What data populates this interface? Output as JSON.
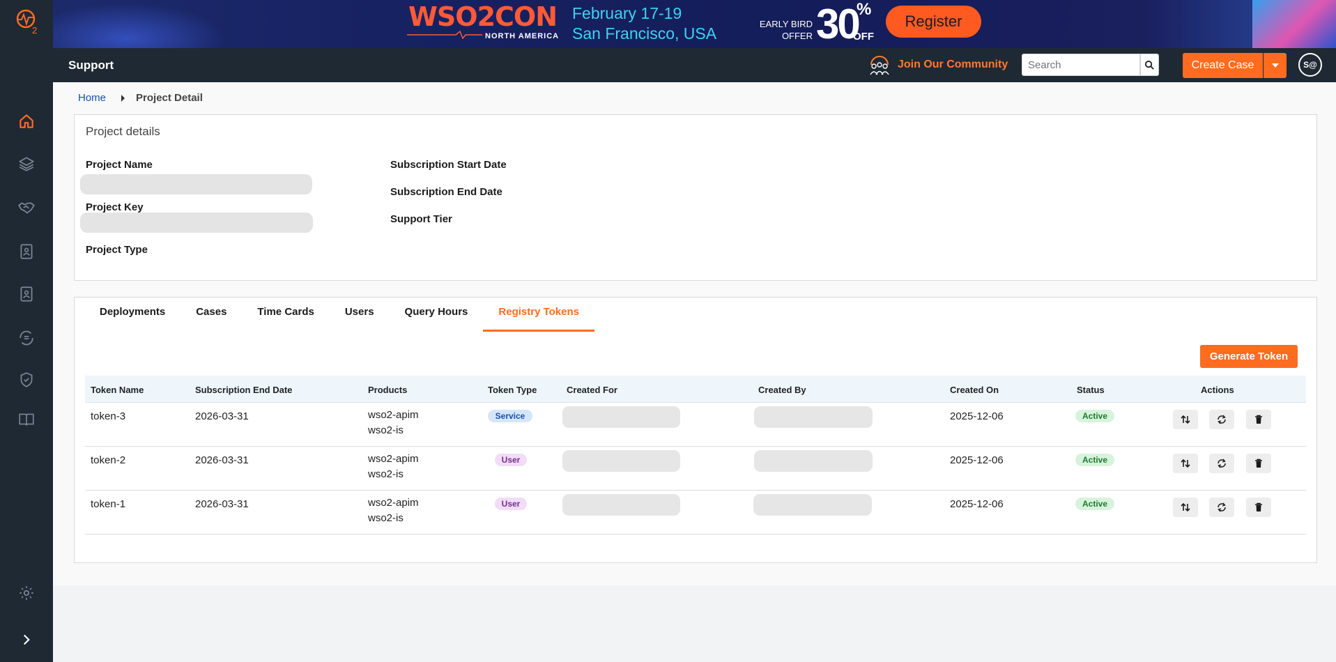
{
  "banner": {
    "brand": "WSO2CON",
    "region": "NORTH AMERICA",
    "dates": "February 17-19",
    "location": "San Francisco, USA",
    "offer_line1": "EARLY BIRD",
    "offer_line2": "OFFER",
    "discount": "30",
    "percent": "%",
    "off": "OFF",
    "register_label": "Register"
  },
  "topbar": {
    "title": "Support",
    "community_label": "Join Our Community",
    "search_placeholder": "Search",
    "create_case_label": "Create Case",
    "avatar_initials": "S@"
  },
  "breadcrumb": {
    "home": "Home",
    "current": "Project Detail"
  },
  "project_details": {
    "title": "Project details",
    "project_name_label": "Project Name",
    "project_key_label": "Project Key",
    "project_type_label": "Project Type",
    "sub_start_label": "Subscription Start Date",
    "sub_end_label": "Subscription End Date",
    "support_tier_label": "Support Tier"
  },
  "tabs": [
    "Deployments",
    "Cases",
    "Time Cards",
    "Users",
    "Query Hours",
    "Registry Tokens"
  ],
  "active_tab": "Registry Tokens",
  "generate_token_label": "Generate Token",
  "table": {
    "columns": [
      "Token Name",
      "Subscription End Date",
      "Products",
      "Token Type",
      "Created For",
      "Created By",
      "Created On",
      "Status",
      "Actions"
    ],
    "rows": [
      {
        "name": "token-3",
        "sub_end": "2026-03-31",
        "product1": "wso2-apim",
        "product2": "wso2-is",
        "type": "Service",
        "created_on": "2025-12-06",
        "status": "Active"
      },
      {
        "name": "token-2",
        "sub_end": "2026-03-31",
        "product1": "wso2-apim",
        "product2": "wso2-is",
        "type": "User",
        "created_on": "2025-12-06",
        "status": "Active"
      },
      {
        "name": "token-1",
        "sub_end": "2026-03-31",
        "product1": "wso2-apim",
        "product2": "wso2-is",
        "type": "User",
        "created_on": "2025-12-06",
        "status": "Active"
      }
    ]
  },
  "colors": {
    "accent": "#ff6b1f",
    "sidebar": "#1f2933",
    "link": "#1a4fb4"
  },
  "icons": {
    "rail": [
      "home-icon",
      "layers-icon",
      "handshake-icon",
      "contact-file-icon",
      "contact-file-icon",
      "sync-list-icon",
      "shield-check-icon",
      "book-icon",
      "settings-icon",
      "chevron-right-icon"
    ],
    "actions": [
      "transfer-arrows-icon",
      "regenerate-icon",
      "delete-icon"
    ]
  }
}
